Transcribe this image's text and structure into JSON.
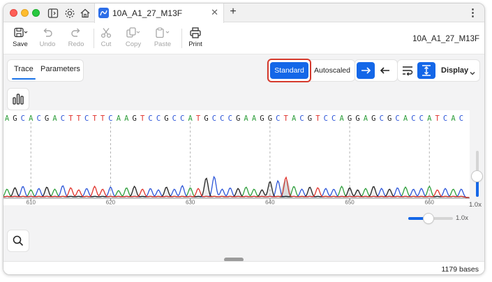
{
  "window": {
    "tab_title": "10A_A1_27_M13F",
    "document_name": "10A_A1_27_M13F"
  },
  "toolbar": {
    "save": "Save",
    "undo": "Undo",
    "redo": "Redo",
    "cut": "Cut",
    "copy": "Copy",
    "paste": "Paste",
    "print": "Print"
  },
  "view_tabs": {
    "trace": "Trace",
    "parameters": "Parameters",
    "selected": "Trace"
  },
  "scale_modes": {
    "standard": "Standard",
    "autoscaled": "Autoscaled",
    "selected": "Standard"
  },
  "display_menu": {
    "label": "Display"
  },
  "sequence": "AGCACGACTTCTTCAAGTCCGCCATGCCCGAAGGCTACGTCCAGGAGCGCACCATCAC",
  "ruler": {
    "ticks": [
      "610",
      "620",
      "630",
      "640",
      "650",
      "660"
    ]
  },
  "zoom": {
    "vertical_label": "1.0x",
    "horizontal_label": "1.0x",
    "vertical_level": 0.45,
    "horizontal_level": 0.45
  },
  "status": {
    "bases": "1179 bases"
  },
  "colors": {
    "A": "#2e9e3b",
    "C": "#2d56d8",
    "G": "#222222",
    "T": "#e0322b",
    "accent": "#1467e8",
    "highlight": "#d63a2d"
  },
  "icons": {
    "save": "save-icon",
    "undo": "undo-icon",
    "redo": "redo-icon",
    "cut": "scissors-icon",
    "copy": "copy-icon",
    "paste": "paste-icon",
    "print": "printer-icon",
    "forward": "arrow-right-icon",
    "reverse": "arrow-left-icon",
    "wrap": "wrap-lines-icon",
    "fit": "fit-height-icon",
    "chart": "bar-chart-icon",
    "search": "search-icon"
  }
}
